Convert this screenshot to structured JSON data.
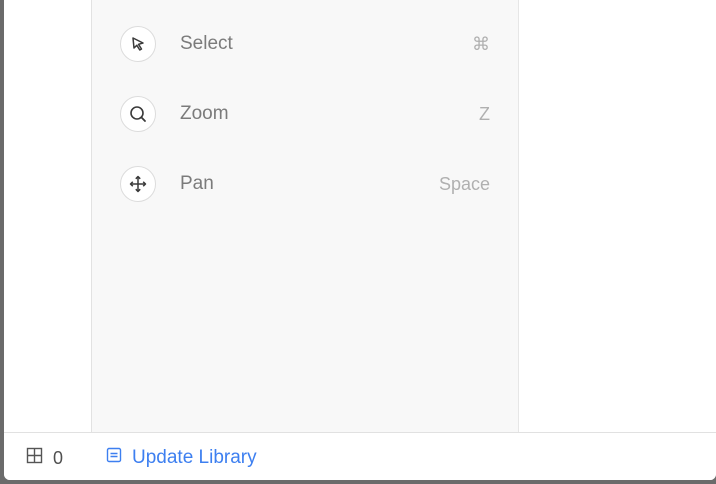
{
  "tools": [
    {
      "label": "Select",
      "shortcut": "⌘",
      "icon": "cursor-icon"
    },
    {
      "label": "Zoom",
      "shortcut": "Z",
      "icon": "magnifier-icon"
    },
    {
      "label": "Pan",
      "shortcut": "Space",
      "icon": "move-arrows-icon"
    }
  ],
  "status": {
    "count_icon": "grid-icon",
    "count": "0",
    "update_icon": "library-doc-icon",
    "update_label": "Update Library"
  },
  "colors": {
    "accent": "#3d7ff0",
    "panel_bg": "#f8f8f8"
  }
}
